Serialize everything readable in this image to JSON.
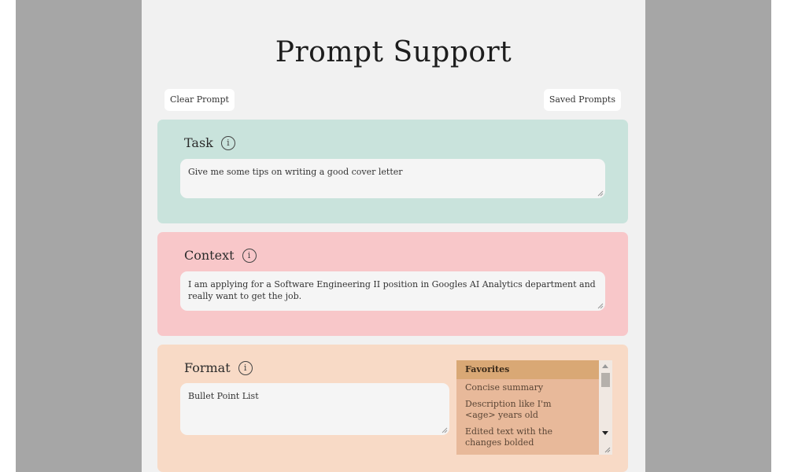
{
  "header": {
    "title": "Prompt Support"
  },
  "toolbar": {
    "clear_label": "Clear Prompt",
    "saved_label": "Saved Prompts"
  },
  "task": {
    "label": "Task",
    "value": "Give me some tips on writing a good cover letter"
  },
  "context": {
    "label": "Context",
    "value": "I am applying for a Software Engineering II position in Googles AI Analytics department and really want to get the job."
  },
  "format": {
    "label": "Format",
    "value": "Bullet Point List",
    "options_header": "Favorites",
    "options": [
      "Concise summary",
      "Description like I'm <age> years old",
      "Edited text with the changes bolded"
    ]
  },
  "icons": {
    "info": "info-circle-icon",
    "resize": "resize-grip-icon"
  },
  "colors": {
    "backdrop": "#a6a6a6",
    "page": "#f1f1f1",
    "task_card": "#c9e3dc",
    "context_card": "#f8c7c9",
    "format_card": "#f8dac6",
    "favorites_header": "#d9a875",
    "favorites_list": "#e8b99a"
  }
}
